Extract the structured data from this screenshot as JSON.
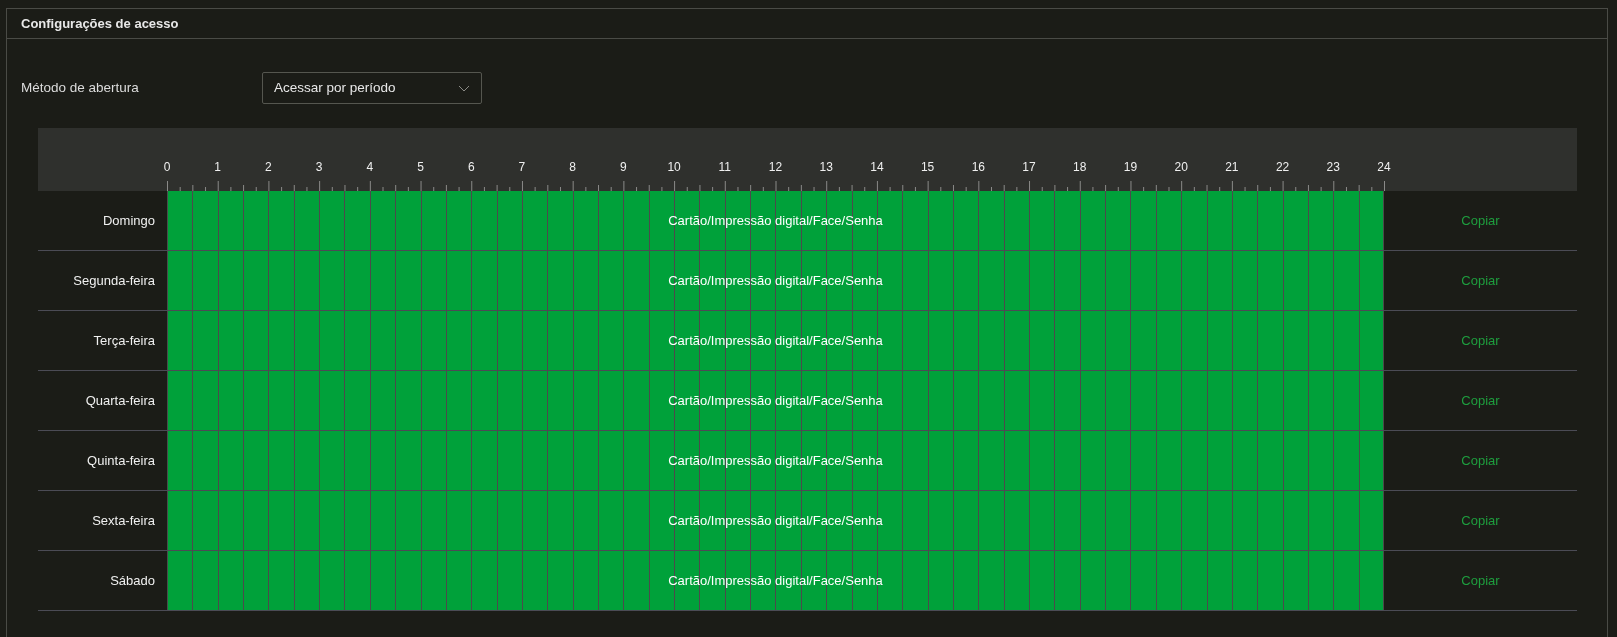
{
  "panel": {
    "title": "Configurações de acesso"
  },
  "opening_method": {
    "label": "Método de abertura",
    "value": "Acessar por período"
  },
  "schedule": {
    "hours": [
      "0",
      "1",
      "2",
      "3",
      "4",
      "5",
      "6",
      "7",
      "8",
      "9",
      "10",
      "11",
      "12",
      "13",
      "14",
      "15",
      "16",
      "17",
      "18",
      "19",
      "20",
      "21",
      "22",
      "23",
      "24"
    ],
    "rows": [
      {
        "day": "Domingo",
        "mode": "Cartão/Impressão digital/Face/Senha",
        "level": 1,
        "copy": "Copiar"
      },
      {
        "day": "Segunda-feira",
        "mode": "Cartão/Impressão digital/Face/Senha",
        "level": 1,
        "copy": "Copiar"
      },
      {
        "day": "Terça-feira",
        "mode": "Cartão/Impressão digital/Face/Senha",
        "level": 1,
        "copy": "Copiar"
      },
      {
        "day": "Quarta-feira",
        "mode": "Cartão/Impressão digital/Face/Senha",
        "level": 1,
        "copy": "Copiar"
      },
      {
        "day": "Quinta-feira",
        "mode": "Cartão/Impressão digital/Face/Senha",
        "level": 1,
        "copy": "Copiar"
      },
      {
        "day": "Sexta-feira",
        "mode": "Cartão/Impressão digital/Face/Senha",
        "level": 1,
        "copy": "Copiar"
      },
      {
        "day": "Sábado",
        "mode": "Cartão/Impressão digital/Face/Senha",
        "level": 1,
        "copy": "Copiar"
      }
    ]
  }
}
